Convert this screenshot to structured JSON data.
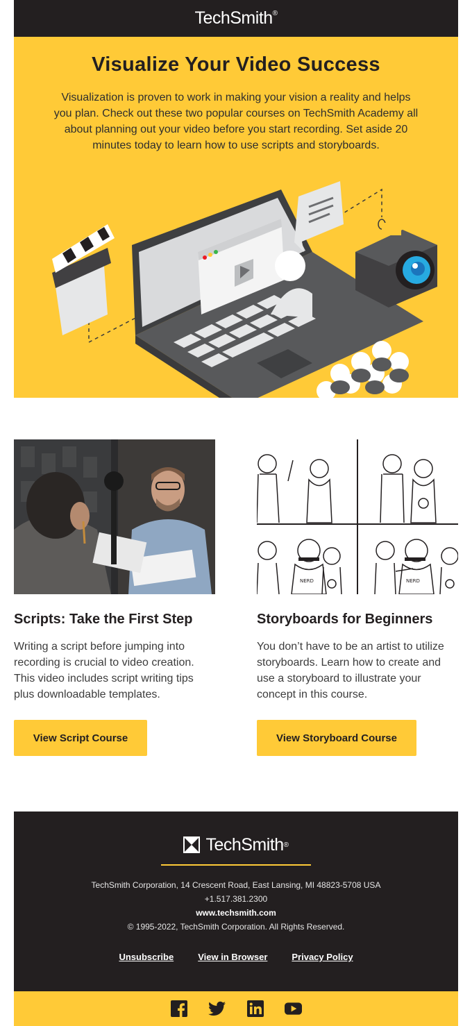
{
  "header": {
    "brand": "TechSmith",
    "reg": "®"
  },
  "hero": {
    "title": "Visualize Your Video Success",
    "body": "Visualization is proven to work in making your vision a reality and helps you plan. Check out these two popular courses on TechSmith Academy all about planning out your video before you start recording. Set aside 20 minutes today to learn how to use scripts and storyboards."
  },
  "courses": [
    {
      "title": "Scripts: Take the First Step",
      "description": "Writing a script before jumping into recording is crucial to video creation. This video includes script writing tips plus downloadable templates.",
      "button": "View Script Course"
    },
    {
      "title": "Storyboards for Beginners",
      "description": "You don’t have to be an artist to utilize storyboards. Learn how to create and use a storyboard to illustrate your concept in this course.",
      "button": "View Storyboard Course"
    }
  ],
  "footer": {
    "brand": "TechSmith",
    "reg": "®",
    "address": "TechSmith Corporation, 14 Crescent Road, East Lansing, MI 48823-5708 USA",
    "phone": "+1.517.381.2300",
    "website": "www.techsmith.com",
    "copyright": "© 1995-2022, TechSmith Corporation. All Rights Reserved.",
    "links": [
      "Unsubscribe",
      "View in Browser",
      "Privacy Policy"
    ]
  },
  "social": [
    "facebook-icon",
    "twitter-icon",
    "linkedin-icon",
    "youtube-icon"
  ],
  "colors": {
    "accent": "#ffca37",
    "dark": "#231f20"
  }
}
